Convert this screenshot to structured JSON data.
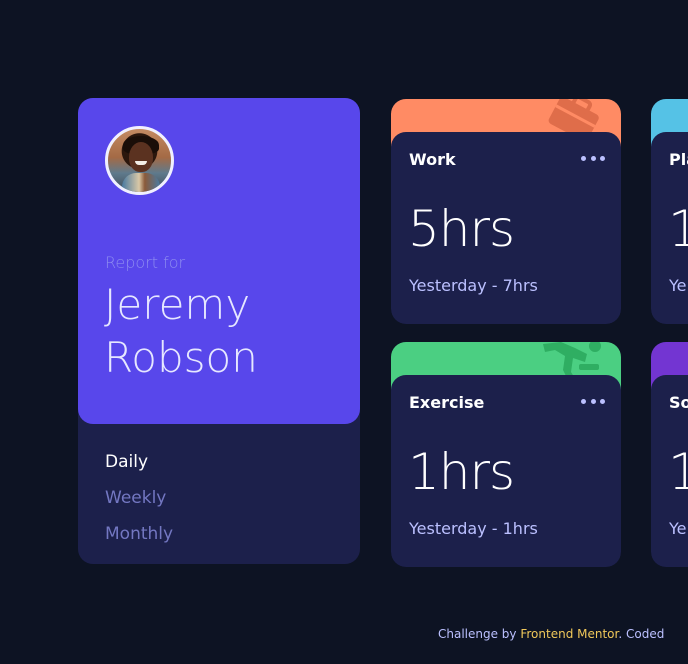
{
  "profile": {
    "report_for": "Report for",
    "name_first": "Jeremy",
    "name_last": "Robson",
    "periods": [
      "Daily",
      "Weekly",
      "Monthly"
    ],
    "active_period": "Daily"
  },
  "cards": [
    {
      "title": "Work",
      "hours": "5hrs",
      "previous": "Yesterday - 7hrs",
      "color": "#ff8b64",
      "icon": "briefcase-icon"
    },
    {
      "title": "Play",
      "hours": "1",
      "previous": "Ye",
      "color": "#55c2e6",
      "icon": "game-icon"
    },
    {
      "title": "Exercise",
      "hours": "1hrs",
      "previous": "Yesterday - 1hrs",
      "color": "#4bcf82",
      "icon": "runner-icon"
    },
    {
      "title": "So",
      "hours": "1",
      "previous": "Ye",
      "color": "#7335d2",
      "icon": "heart-icon"
    }
  ],
  "footer": {
    "prefix": "Challenge by",
    "link": "Frontend Mentor",
    "suffix": ". Coded"
  }
}
